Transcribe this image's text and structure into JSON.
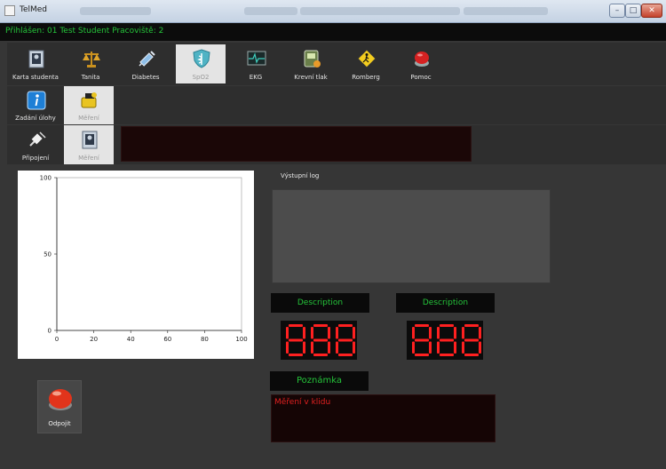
{
  "window": {
    "title": "TelMed",
    "status_text": "Přihlášen: 01 Test Student Pracoviště: 2",
    "buttons": {
      "minimize": "–",
      "maximize": "□",
      "close": "✕"
    }
  },
  "main_tabs": [
    {
      "label": "Karta studenta",
      "icon": "student-card-icon",
      "selected": false
    },
    {
      "label": "Tanita",
      "icon": "scale-icon",
      "selected": false
    },
    {
      "label": "Diabetes",
      "icon": "syringe-icon",
      "selected": false
    },
    {
      "label": "SpO2",
      "icon": "caduceus-icon",
      "selected": true
    },
    {
      "label": "EKG",
      "icon": "ecg-monitor-icon",
      "selected": false
    },
    {
      "label": "Krevní tlak",
      "icon": "blood-pressure-icon",
      "selected": false
    },
    {
      "label": "Romberg",
      "icon": "romberg-sign-icon",
      "selected": false
    },
    {
      "label": "Pomoc",
      "icon": "help-button-icon",
      "selected": false
    }
  ],
  "sub_tabs_1": [
    {
      "label": "Zadání úlohy",
      "icon": "info-icon",
      "selected": false
    },
    {
      "label": "Měření",
      "icon": "measure-tape-icon",
      "selected": true
    }
  ],
  "sub_tabs_2": [
    {
      "label": "Připojení",
      "icon": "plug-icon",
      "selected": false
    },
    {
      "label": "Měření",
      "icon": "student-card-icon",
      "selected": true
    }
  ],
  "chart_data": {
    "type": "line",
    "title": "",
    "xlabel": "",
    "ylabel": "",
    "xlim": [
      0,
      100
    ],
    "ylim": [
      0,
      100
    ],
    "x_ticks": [
      0,
      20,
      40,
      60,
      80,
      100
    ],
    "y_ticks": [
      0,
      50,
      100
    ],
    "series": []
  },
  "output_log": {
    "label": "Výstupní log",
    "content": ""
  },
  "displays": [
    {
      "description": "Description",
      "value": "888"
    },
    {
      "description": "Description",
      "value": "888"
    }
  ],
  "note": {
    "label": "Poznámka",
    "text": "Měření v klidu"
  },
  "disconnect_button": {
    "label": "Odpojit",
    "icon": "red-stop-button-icon"
  },
  "colors": {
    "status_green": "#25c43a",
    "segment_red": "#ff2020",
    "note_text_red": "#e02020",
    "background": "#363636"
  }
}
